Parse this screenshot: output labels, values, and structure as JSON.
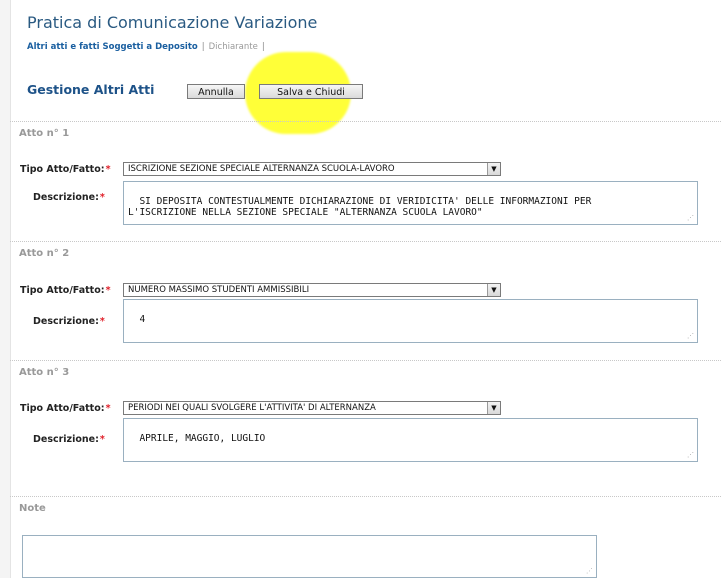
{
  "header": {
    "title": "Pratica di Comunicazione Variazione",
    "breadcrumb_link": "Altri atti e fatti Soggetti a Deposito",
    "breadcrumb_item": "Dichiarante",
    "sep1": "|",
    "sep2": "|"
  },
  "toolbar": {
    "section_title": "Gestione Altri Atti",
    "cancel_label": "Annulla",
    "save_label": "Salva e Chiudi"
  },
  "labels": {
    "tipo": "Tipo Atto/Fatto:",
    "descrizione": "Descrizione:",
    "required_mark": "*"
  },
  "acts": [
    {
      "title": "Atto n° 1",
      "tipo_value": "ISCRIZIONE SEZIONE SPECIALE ALTERNANZA SCUOLA-LAVORO",
      "descrizione": "SI DEPOSITA CONTESTUALMENTE DICHIARAZIONE DI VERIDICITA' DELLE INFORMAZIONI PER\nL'ISCRIZIONE NELLA SEZIONE SPECIALE \"ALTERNANZA SCUOLA LAVORO\""
    },
    {
      "title": "Atto n° 2",
      "tipo_value": "NUMERO MASSIMO STUDENTI AMMISSIBILI",
      "descrizione": "4"
    },
    {
      "title": "Atto n° 3",
      "tipo_value": "PERIODI NEI QUALI SVOLGERE L'ATTIVITA' DI ALTERNANZA",
      "descrizione": "APRILE, MAGGIO, LUGLIO"
    }
  ],
  "note": {
    "title": "Note",
    "value": ""
  },
  "colors": {
    "title": "#2a5a82",
    "section": "#1d5288",
    "required": "#e0202a",
    "highlight": "#ffff00"
  }
}
